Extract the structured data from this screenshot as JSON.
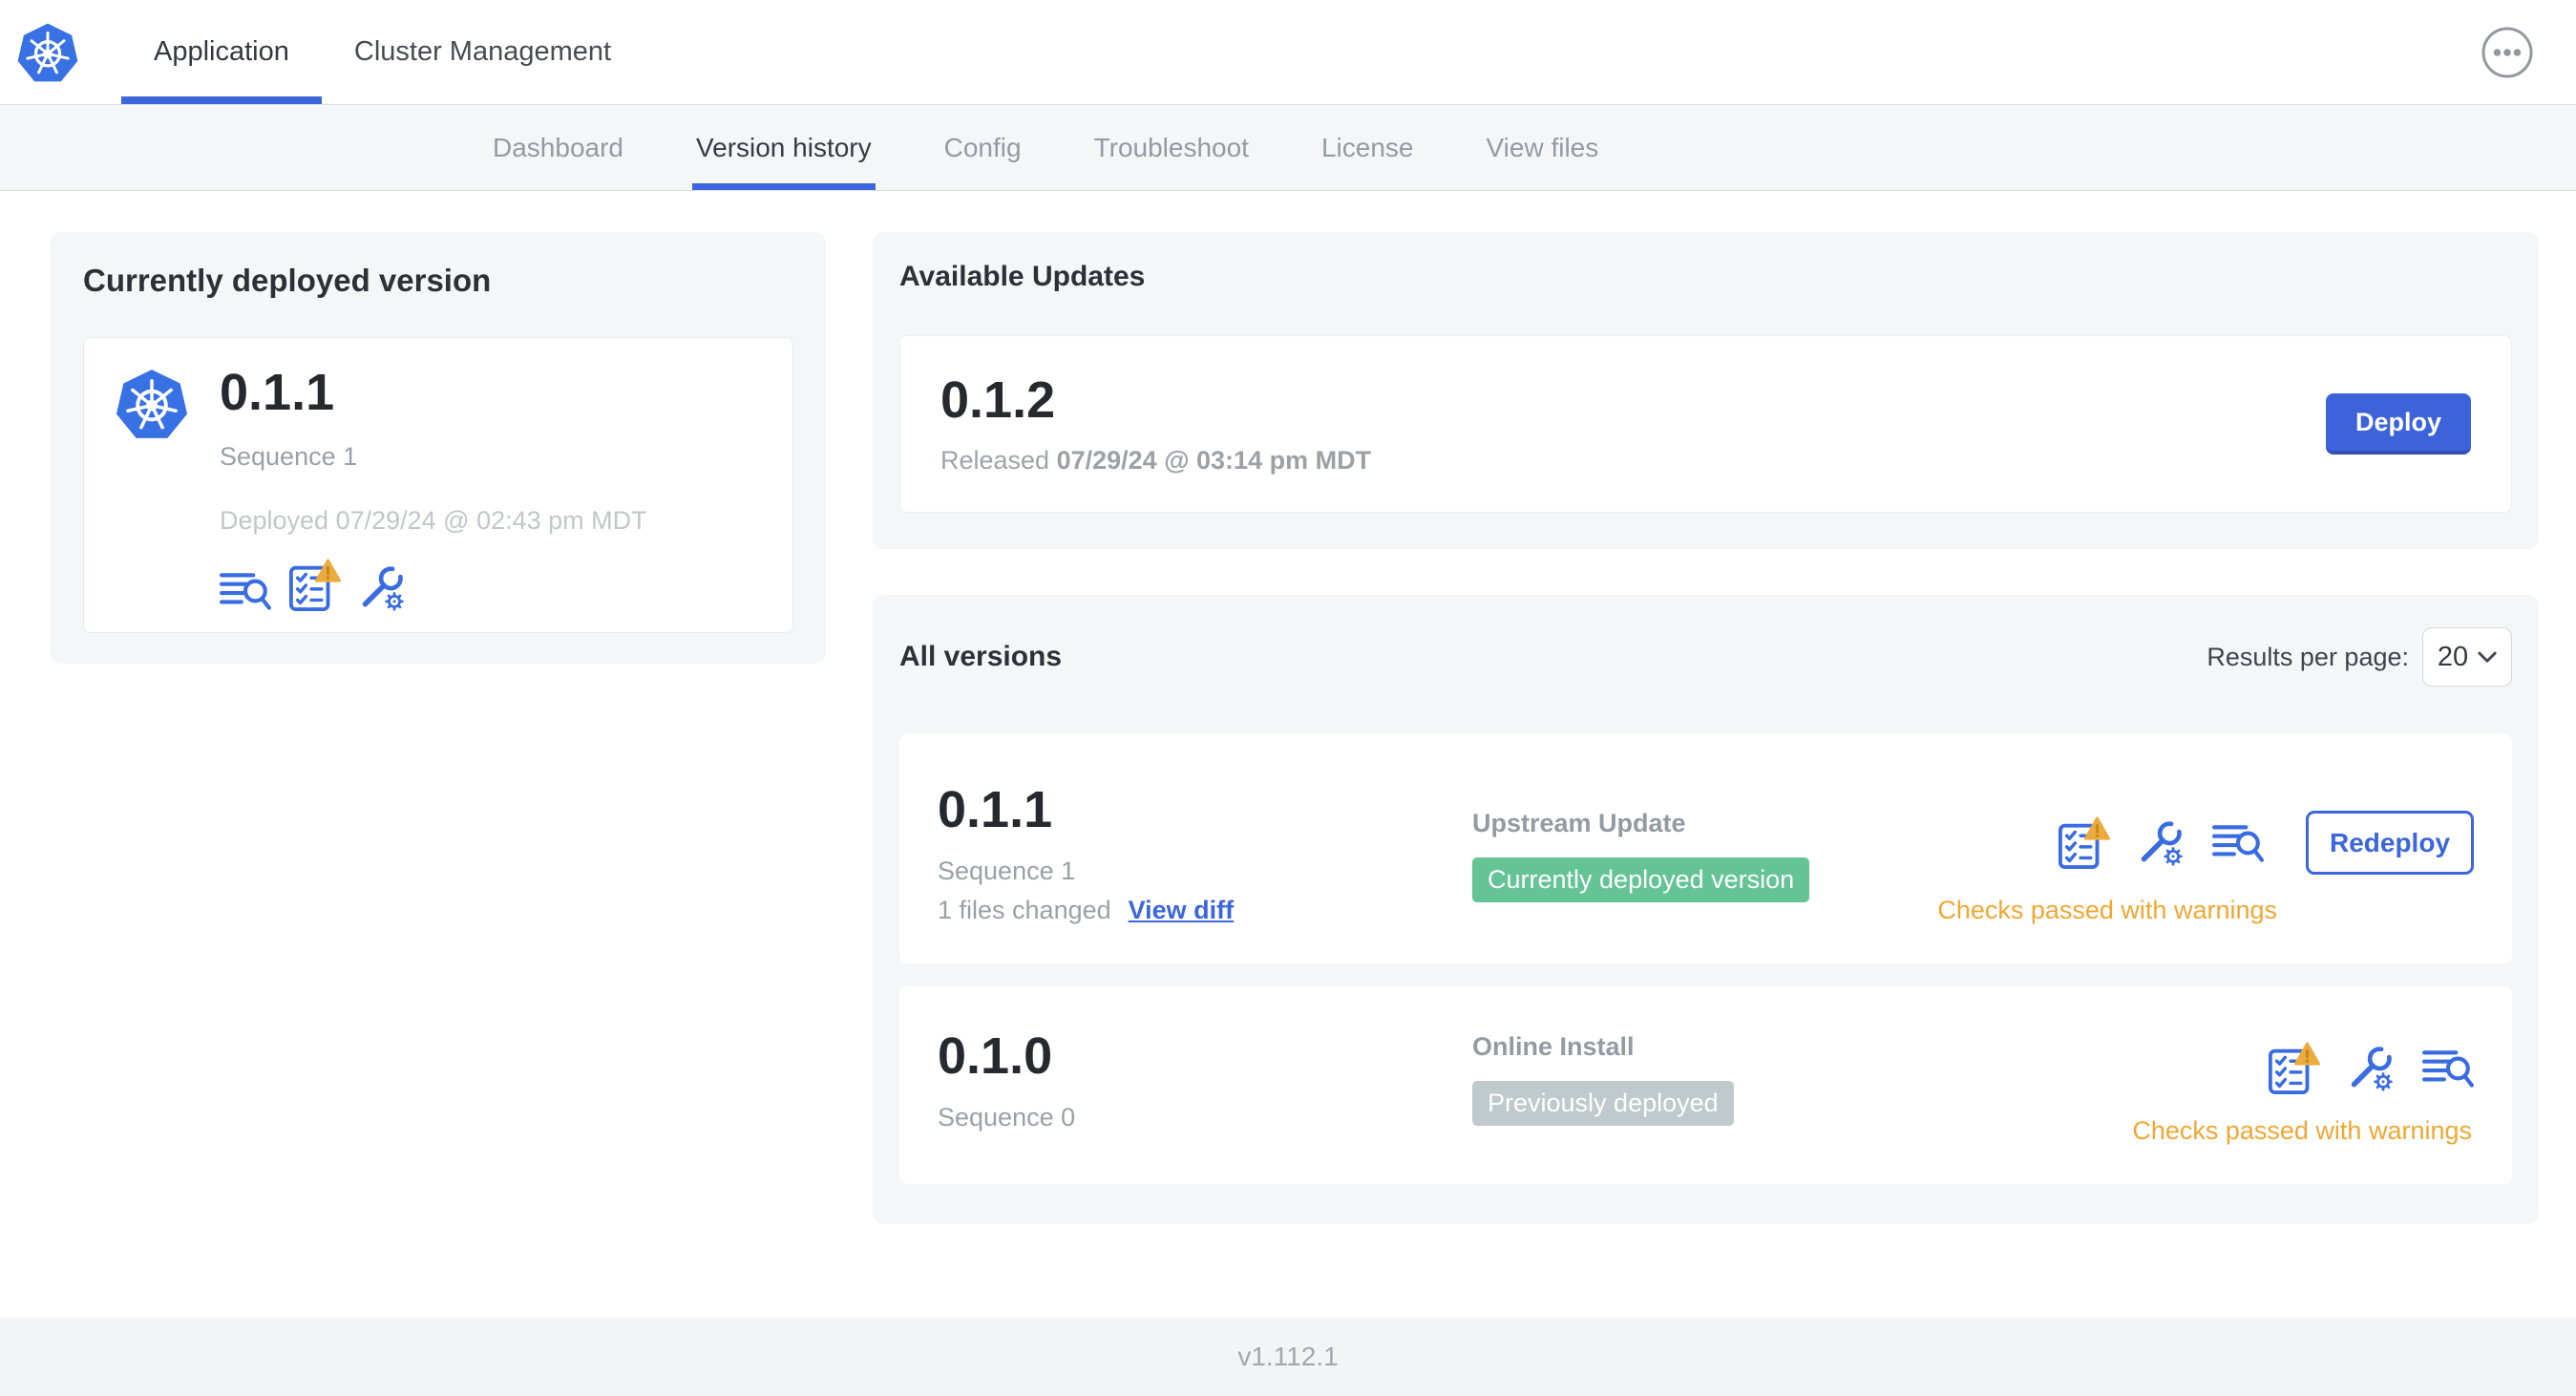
{
  "header": {
    "tabs": [
      {
        "label": "Application",
        "active": true
      },
      {
        "label": "Cluster Management",
        "active": false
      }
    ],
    "menu_icon": "ellipsis-icon"
  },
  "subnav": {
    "items": [
      "Dashboard",
      "Version history",
      "Config",
      "Troubleshoot",
      "License",
      "View files"
    ],
    "active_item": "Version history"
  },
  "currently_deployed": {
    "title": "Currently deployed version",
    "version": "0.1.1",
    "sequence": "Sequence 1",
    "deployed_text": "Deployed 07/29/24 @ 02:43 pm MDT",
    "icons": [
      "logs-icon",
      "preflight-checks-warning-icon",
      "config-icon"
    ]
  },
  "available_updates": {
    "title": "Available Updates",
    "version": "0.1.2",
    "released_label": "Released",
    "released_date": "07/29/24 @ 03:14 pm MDT",
    "deploy_label": "Deploy"
  },
  "all_versions": {
    "title": "All versions",
    "results_per_page_label": "Results per page:",
    "results_per_page_value": "20",
    "rows": [
      {
        "version": "0.1.1",
        "sequence": "Sequence 1",
        "files_changed": "1 files changed",
        "view_diff_label": "View diff",
        "source": "Upstream Update",
        "badge": "Currently deployed version",
        "badge_color": "#64c496",
        "icons": [
          "preflight-checks-warning-icon",
          "config-icon",
          "logs-icon"
        ],
        "action_label": "Redeploy",
        "status": "Checks passed with warnings"
      },
      {
        "version": "0.1.0",
        "sequence": "Sequence 0",
        "source": "Online Install",
        "badge": "Previously deployed",
        "badge_color": "#c0c9cc",
        "icons": [
          "preflight-checks-warning-icon",
          "config-icon",
          "logs-icon"
        ],
        "status": "Checks passed with warnings"
      }
    ]
  },
  "footer": {
    "app_version": "v1.112.1"
  },
  "colors": {
    "accent_blue": "#3b66dc",
    "icon_blue": "#3a6ce1",
    "k8s_blue": "#3871e3",
    "badge_green": "#64c496",
    "badge_gray": "#c0c9cc",
    "warning_orange": "#f0a732",
    "subnav_bg": "#f5f6f8",
    "card_bg": "#f5f6f8"
  }
}
